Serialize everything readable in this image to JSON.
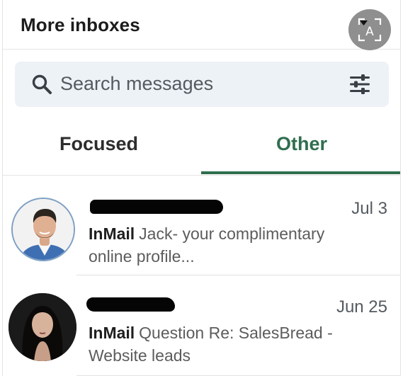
{
  "header": {
    "title": "More inboxes",
    "lens_icon": "text-scan-icon",
    "lens_letter": "A"
  },
  "search": {
    "placeholder": "Search messages",
    "search_icon": "search-icon",
    "filter_icon": "filter-sliders-icon"
  },
  "tabs": [
    {
      "label": "Focused",
      "active": false
    },
    {
      "label": "Other",
      "active": true
    }
  ],
  "colors": {
    "accent": "#2f6e4e",
    "search_bg": "#edf2f7",
    "lens_bg": "#8f8f8f"
  },
  "messages": [
    {
      "sender_redacted": true,
      "date": "Jul 3",
      "tag": "InMail",
      "preview": "Jack- your complimentary online profile..."
    },
    {
      "sender_redacted": true,
      "date": "Jun 25",
      "tag": "InMail",
      "preview": "Question Re: SalesBread - Website leads"
    }
  ]
}
